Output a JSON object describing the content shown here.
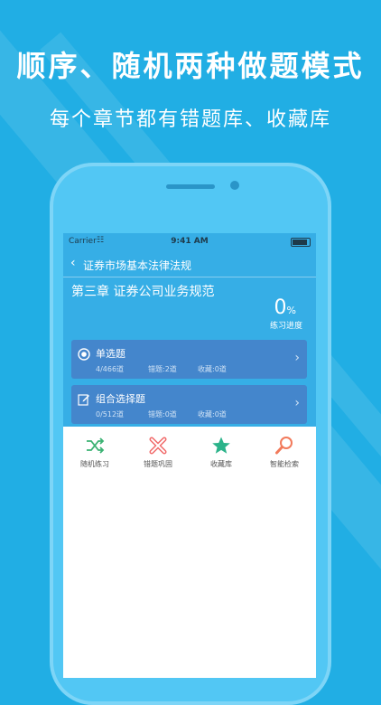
{
  "promo": {
    "headline": "顺序、随机两种做题模式",
    "subheadline": "每个章节都有错题库、收藏库"
  },
  "status_bar": {
    "carrier": "Carrier",
    "time": "9:41 AM"
  },
  "nav": {
    "back_icon": "chevron-left-icon",
    "title": "证券市场基本法律法规"
  },
  "chapter": {
    "title": "第三章 证券公司业务规范",
    "progress_value": "0",
    "progress_unit": "%",
    "progress_label": "练习进度"
  },
  "question_types": [
    {
      "name": "单选题",
      "icon": "radio-target-icon",
      "progress": "4/466道",
      "wrong": "错题:2道",
      "favorites": "收藏:0道"
    },
    {
      "name": "组合选择题",
      "icon": "edit-icon",
      "progress": "0/512道",
      "wrong": "错题:0道",
      "favorites": "收藏:0道"
    }
  ],
  "tabs": [
    {
      "label": "随机练习",
      "icon": "shuffle-icon",
      "color": "#3bb273"
    },
    {
      "label": "错题巩固",
      "icon": "cross-icon",
      "color": "#f16a6a"
    },
    {
      "label": "收藏库",
      "icon": "star-icon",
      "color": "#2bb38a"
    },
    {
      "label": "智能检索",
      "icon": "search-icon",
      "color": "#f27a5b"
    }
  ],
  "colors": {
    "background": "#21aee4",
    "app_header": "#36aee6",
    "card": "#4486cc"
  }
}
